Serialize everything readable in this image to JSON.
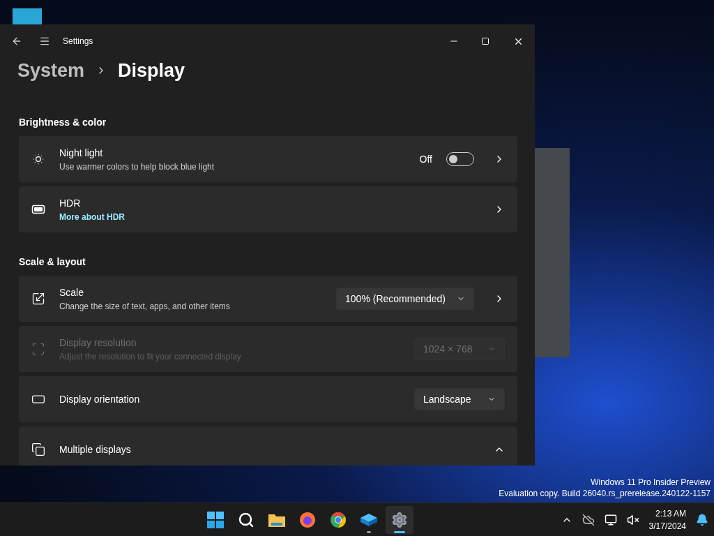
{
  "window": {
    "title": "Settings"
  },
  "breadcrumb": [
    {
      "label": "System",
      "current": false
    },
    {
      "label": "Display",
      "current": true
    }
  ],
  "sections": [
    {
      "title": "Brightness & color",
      "rows": [
        {
          "kind": "toggle",
          "title": "Night light",
          "subtitle": "Use warmer colors to help block blue light",
          "value": "Off",
          "on": false,
          "disabled": false
        },
        {
          "kind": "link",
          "title": "HDR",
          "link": "More about HDR",
          "disabled": false
        }
      ]
    },
    {
      "title": "Scale & layout",
      "rows": [
        {
          "kind": "dropdown",
          "title": "Scale",
          "subtitle": "Change the size of text, apps, and other items",
          "value": "100% (Recommended)",
          "disabled": false,
          "chevron": true
        },
        {
          "kind": "dropdown",
          "title": "Display resolution",
          "subtitle": "Adjust the resolution to fit your connected display",
          "value": "1024 × 768",
          "disabled": true,
          "chevron": false
        },
        {
          "kind": "dropdown",
          "title": "Display orientation",
          "value": "Landscape",
          "disabled": false,
          "chevron": false
        },
        {
          "kind": "expander",
          "title": "Multiple displays",
          "expanded": true,
          "disabled": false
        }
      ]
    }
  ],
  "watermark_lines": [
    "Windows 11 Pro Insider Preview",
    "Evaluation copy. Build 26040.rs_prerelease.240122-1157"
  ],
  "taskbar": {
    "apps": [
      {
        "kind": "start",
        "running": false,
        "selected": false
      },
      {
        "kind": "search",
        "running": false,
        "selected": false
      },
      {
        "kind": "explorer",
        "running": false,
        "selected": false
      },
      {
        "kind": "firefox",
        "running": false,
        "selected": false
      },
      {
        "kind": "chrome",
        "running": false,
        "selected": false
      },
      {
        "kind": "box",
        "running": true,
        "selected": false
      },
      {
        "kind": "settings",
        "running": true,
        "selected": true
      }
    ],
    "time": "2:13 AM",
    "date": "3/17/2024"
  }
}
